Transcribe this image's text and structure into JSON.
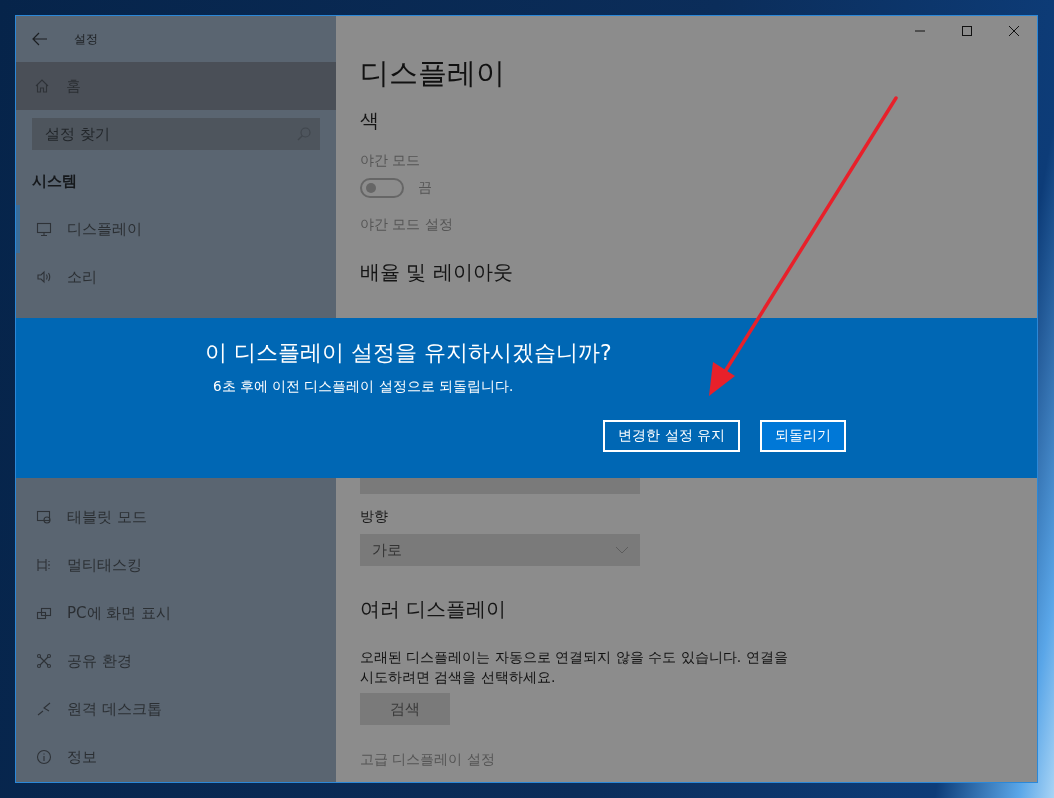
{
  "window": {
    "title": "설정"
  },
  "sidebar": {
    "home": "홈",
    "search": {
      "placeholder": "설정 찾기"
    },
    "section": "시스템",
    "items_above": [
      {
        "label": "디스플레이",
        "selected": true
      },
      {
        "label": "소리",
        "selected": false
      }
    ],
    "items_below": [
      {
        "label": "태블릿 모드",
        "selected": false
      },
      {
        "label": "멀티태스킹",
        "selected": false
      },
      {
        "label": "PC에 화면 표시",
        "selected": false
      },
      {
        "label": "공유 환경",
        "selected": false
      },
      {
        "label": "원격 데스크톱",
        "selected": false
      },
      {
        "label": "정보",
        "selected": false
      }
    ]
  },
  "main": {
    "title": "디스플레이",
    "color_section": {
      "heading": "색",
      "night_light_label": "야간 모드",
      "night_light": {
        "on": false,
        "state_label": "끔"
      },
      "night_light_settings_link": "야간 모드 설정"
    },
    "scale_section": {
      "heading": "배율 및 레이아웃",
      "orientation": {
        "label": "방향",
        "value": "가로"
      }
    },
    "multiple_displays": {
      "heading": "여러 디스플레이",
      "description": "오래된 디스플레이는 자동으로 연결되지 않을 수도 있습니다. 연결을 시도하려면 검색을 선택하세요.",
      "detect_button": "검색",
      "advanced_link": "고급 디스플레이 설정"
    }
  },
  "dialog": {
    "title": "이 디스플레이 설정을 유지하시겠습니까?",
    "message": "6초 후에 이전 디스플레이 설정으로 되돌립니다.",
    "buttons": [
      {
        "label": "변경한 설정 유지",
        "kind": "outline"
      },
      {
        "label": "되돌리기",
        "kind": "accent"
      }
    ]
  }
}
